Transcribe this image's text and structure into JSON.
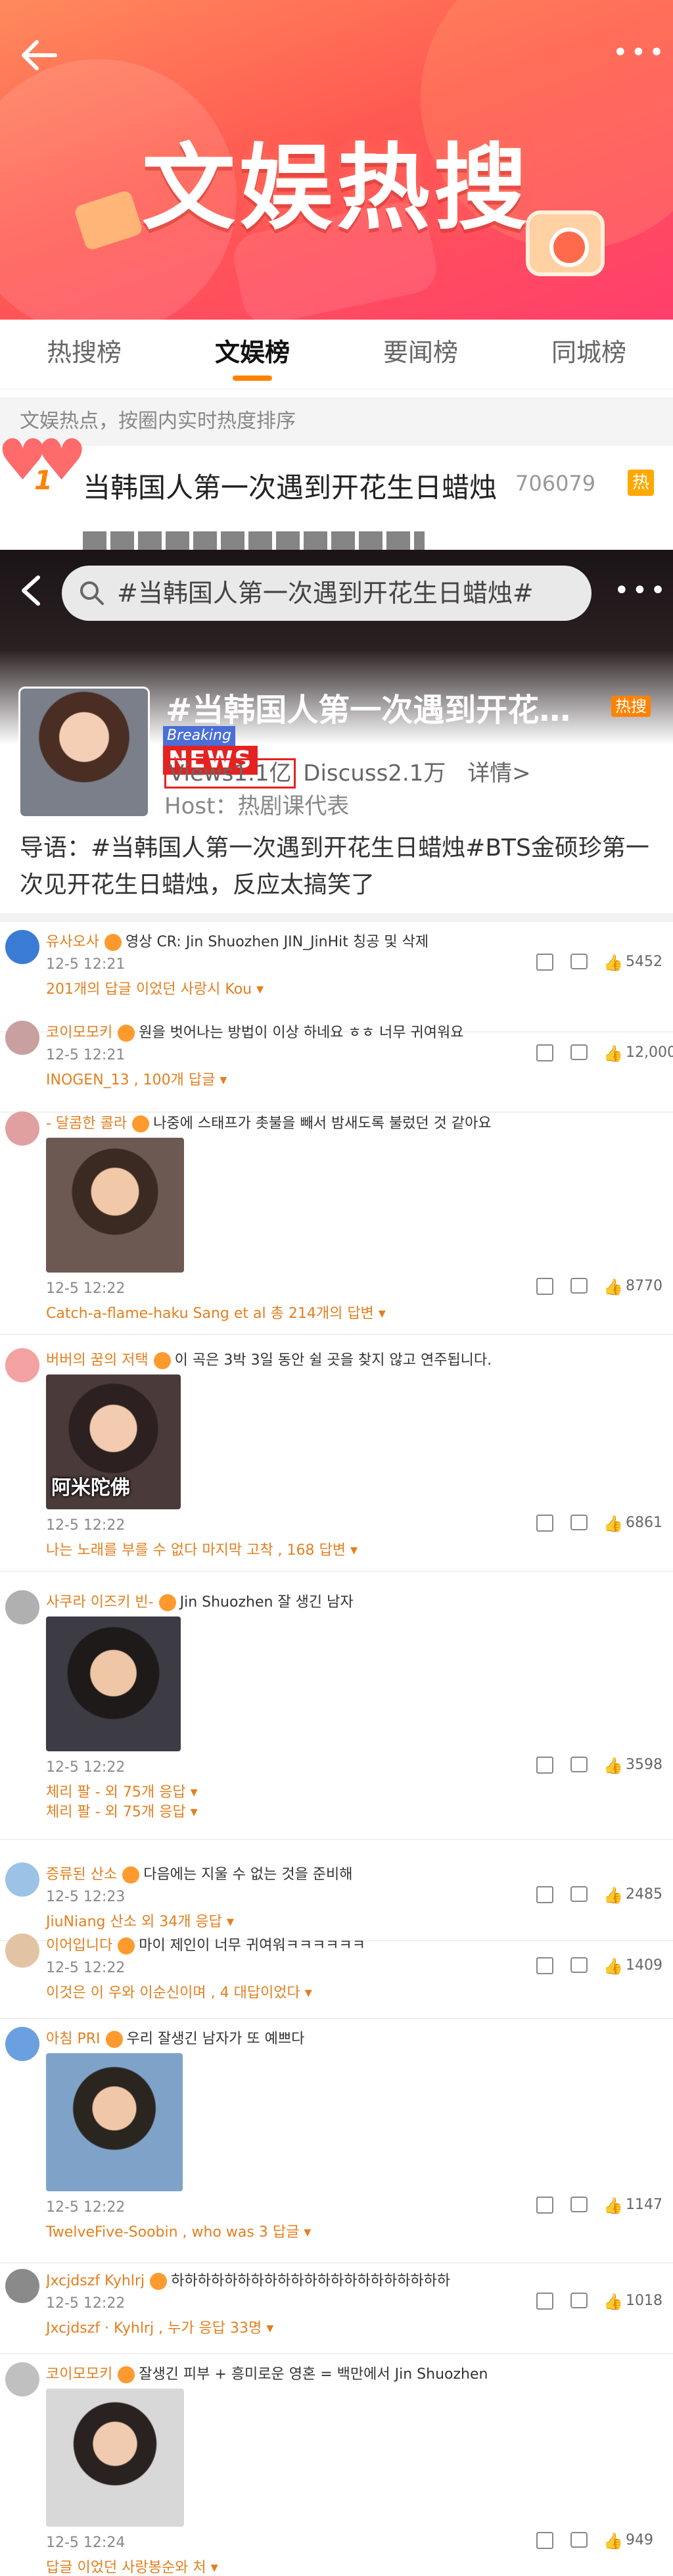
{
  "banner": {
    "title": "文娱热搜"
  },
  "tabs": [
    {
      "label": "热搜榜"
    },
    {
      "label": "文娱榜"
    },
    {
      "label": "要闻榜"
    },
    {
      "label": "同城榜"
    }
  ],
  "hint": "文娱热点，按圈内实时热度排序",
  "rank": {
    "number": "1",
    "title": "当韩国人第一次遇到开花生日蜡烛",
    "count": "706079",
    "badge": "热"
  },
  "topic": {
    "search_text": "#当韩国人第一次遇到开花生日蜡烛#",
    "name": "#当韩国人第一次遇到开花生日...",
    "hot_tag": "热搜",
    "breaking": "Breaking",
    "news": "NEWS",
    "views": "Views1.1亿",
    "discuss": "Discuss2.1万",
    "detail": "详情>",
    "host": "Host：热剧课代表",
    "summary": "导语：#当韩国人第一次遇到开花生日蜡烛#BTS金硕珍第一次见开花生日蜡烛，反应太搞笑了"
  },
  "comments": [
    {
      "user": "유사오사",
      "text": "영상 CR: Jin Shuozhen JIN_JinHit 칭공 및 삭제",
      "time": "12-5 12:21",
      "likes": "5452",
      "reply": "201개의 답글 이었던 사랑시 Kou ▾"
    },
    {
      "user": "코이모모키",
      "text": "원을 벗어나는 방법이 이상 하네요 ㅎㅎ 너무 귀여워요",
      "time": "12-5 12:21",
      "likes": "12,000",
      "reply": "INOGEN_13 , 100개 답글 ▾"
    },
    {
      "user": "- 달콤한 콜라",
      "text": "나중에 스태프가 촛불을 빼서 밤새도록 불렀던 것 같아요",
      "time": "12-5 12:22",
      "likes": "8770",
      "reply": "Catch-a-flame-haku Sang et al 총 214개의 답변 ▾"
    },
    {
      "user": "버버의 꿈의 저택",
      "text": "이 곡은 3박 3일 동안 쉴 곳을 찾지 않고 연주됩니다.",
      "time": "12-5 12:22",
      "likes": "6861",
      "reply": "나는 노래를 부를 수 없다 마지막 고착 , 168 답변 ▾",
      "image_caption": "阿米陀佛"
    },
    {
      "user": "사쿠라 이즈키 빈-",
      "text": "Jin Shuozhen 잘 생긴 남자",
      "time": "12-5 12:22",
      "likes": "3598",
      "reply": "체리 팔 - 외 75개 응답 ▾",
      "reply2": "체리 팔 - 외 75개 응답 ▾"
    },
    {
      "user": "증류된 산소",
      "text": "다음에는 지울 수 없는 것을 준비해",
      "time": "12-5 12:23",
      "likes": "2485",
      "reply": "JiuNiang 산소 외 34개 응답 ▾"
    },
    {
      "user": "이어입니다",
      "text": "마이 제인이 너무 귀여워ㅋㅋㅋㅋㅋㅋ",
      "time": "12-5 12:22",
      "likes": "1409",
      "reply": "이것은 이 우와 이순신이며 , 4 대답이었다 ▾"
    },
    {
      "user": "아침 PRI",
      "text": "우리 잘생긴 남자가 또 예쁘다",
      "time": "12-5 12:22",
      "likes": "1147",
      "reply": "TwelveFive-Soobin , who was 3 답글 ▾"
    },
    {
      "user": "Jxcjdszf Kyhlrj",
      "text": "하하하하하하하하하하하하하하하하하하하하하",
      "time": "12-5 12:22",
      "likes": "1018",
      "reply": "Jxcjdszf · Kyhlrj , 누가 응답 33명 ▾"
    },
    {
      "user": "코이모모키",
      "text": "잘생긴 피부 + 흥미로운 영혼 = 백만에서 Jin Shuozhen",
      "time": "12-5 12:24",
      "likes": "949",
      "reply": "답글 이었던 사랑봉순와 처 ▾"
    }
  ],
  "colors": {
    "brand": "#ff8200",
    "username": "#e37f1e",
    "banner_start": "#ff8a5c",
    "banner_end": "#ff3f6c"
  }
}
